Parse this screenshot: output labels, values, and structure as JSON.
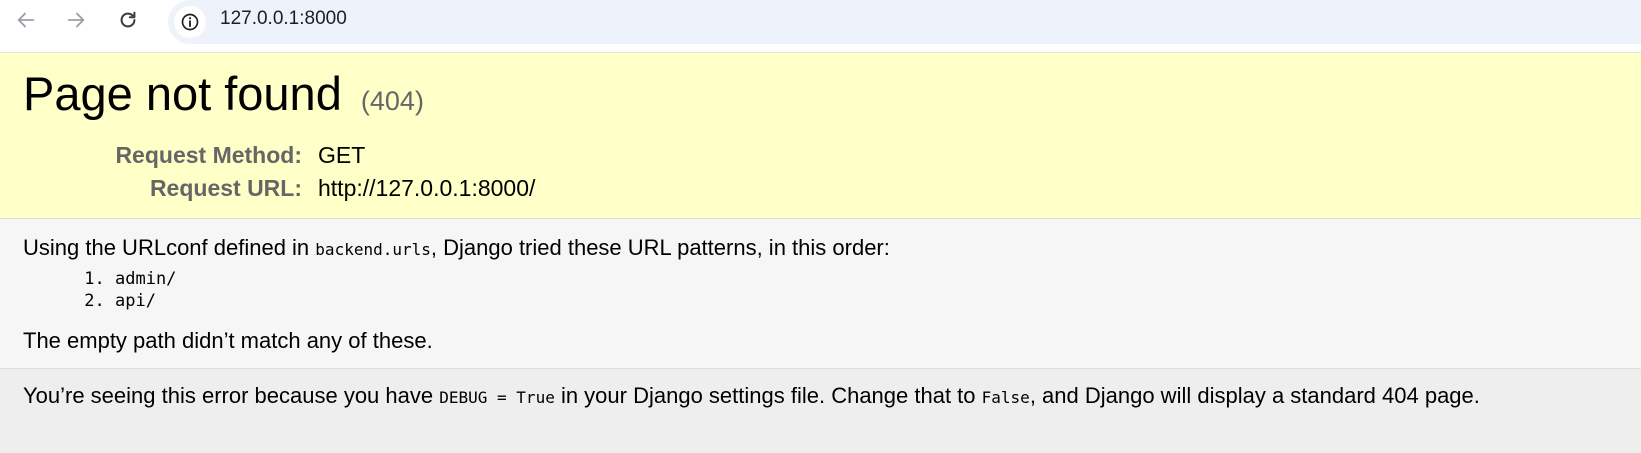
{
  "browser": {
    "url": "127.0.0.1:8000",
    "icons": {
      "back": "arrow-left-icon",
      "forward": "arrow-right-icon",
      "reload": "reload-icon",
      "site_info": "info-circle-icon"
    }
  },
  "summary": {
    "title": "Page not found",
    "code": "(404)",
    "request_method_label": "Request Method:",
    "request_method_value": "GET",
    "request_url_label": "Request URL:",
    "request_url_value": "http://127.0.0.1:8000/"
  },
  "info": {
    "urlconf_prefix": "Using the URLconf defined in ",
    "urlconf_module": "backend.urls",
    "urlconf_suffix": ", Django tried these URL patterns, in this order:",
    "patterns": [
      "admin/",
      "api/"
    ],
    "no_match": "The empty path didn’t match any of these."
  },
  "explanation": {
    "part1": "You’re seeing this error because you have ",
    "debug_setting": "DEBUG = True",
    "part2": " in your Django settings file. Change that to ",
    "false_value": "False",
    "part3": ", and Django will display a standard 404 page."
  },
  "colors": {
    "summary_bg": "#ffffc8",
    "info_bg": "#f6f6f6",
    "explanation_bg": "#eeeeee",
    "label_gray": "#666666",
    "omnibox_bg": "#eef2fb"
  }
}
